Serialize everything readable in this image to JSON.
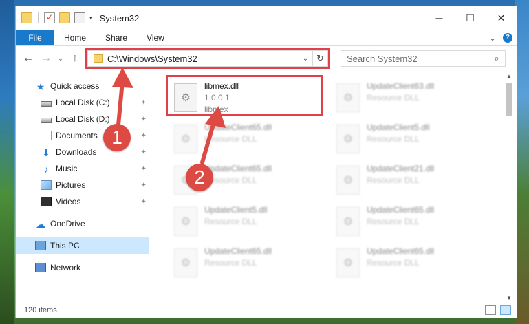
{
  "window": {
    "title": "System32",
    "controls": {
      "minimize": "─",
      "maximize": "☐",
      "close": "✕"
    }
  },
  "ribbon": {
    "tabs": [
      "File",
      "Home",
      "Share",
      "View"
    ],
    "collapse_glyph": "⌄",
    "help_glyph": "?"
  },
  "address": {
    "back_glyph": "←",
    "forward_glyph": "→",
    "recent_glyph": "⌄",
    "up_glyph": "↑",
    "path": "C:\\Windows\\System32",
    "dropdown_glyph": "⌄",
    "refresh_glyph": "↻"
  },
  "search": {
    "placeholder": "Search System32",
    "icon_glyph": "⌕"
  },
  "sidebar": {
    "quick_access": "Quick access",
    "items": [
      {
        "label": "Local Disk (C:)"
      },
      {
        "label": "Local Disk (D:)"
      },
      {
        "label": "Documents"
      },
      {
        "label": "Downloads"
      },
      {
        "label": "Music"
      },
      {
        "label": "Pictures"
      },
      {
        "label": "Videos"
      }
    ],
    "pin_glyph": "📌",
    "onedrive": "OneDrive",
    "this_pc": "This PC",
    "network": "Network"
  },
  "files": [
    {
      "name": "libmex.dll",
      "line2": "1.0.0.1",
      "line3": "libmex"
    },
    {
      "name": "UpdateClient63.dll",
      "line2": "Resource DLL"
    },
    {
      "name": "UpdateClient65.dll",
      "line2": "Resource DLL"
    },
    {
      "name": "UpdateClient5.dll",
      "line2": "Resource DLL"
    },
    {
      "name": "UpdateClient65.dll",
      "line2": "Resource DLL"
    },
    {
      "name": "UpdateClient21.dll",
      "line2": "Resource DLL"
    },
    {
      "name": "UpdateClient5.dll",
      "line2": "Resource DLL"
    },
    {
      "name": "UpdateClient65.dll",
      "line2": "Resource DLL"
    },
    {
      "name": "UpdateClient65.dll",
      "line2": "Resource DLL"
    },
    {
      "name": "UpdateClient65.dll",
      "line2": "Resource DLL"
    }
  ],
  "status": {
    "item_count": "120 items"
  },
  "annotations": {
    "badge1": "1",
    "badge2": "2",
    "color": "#dd4a43"
  }
}
